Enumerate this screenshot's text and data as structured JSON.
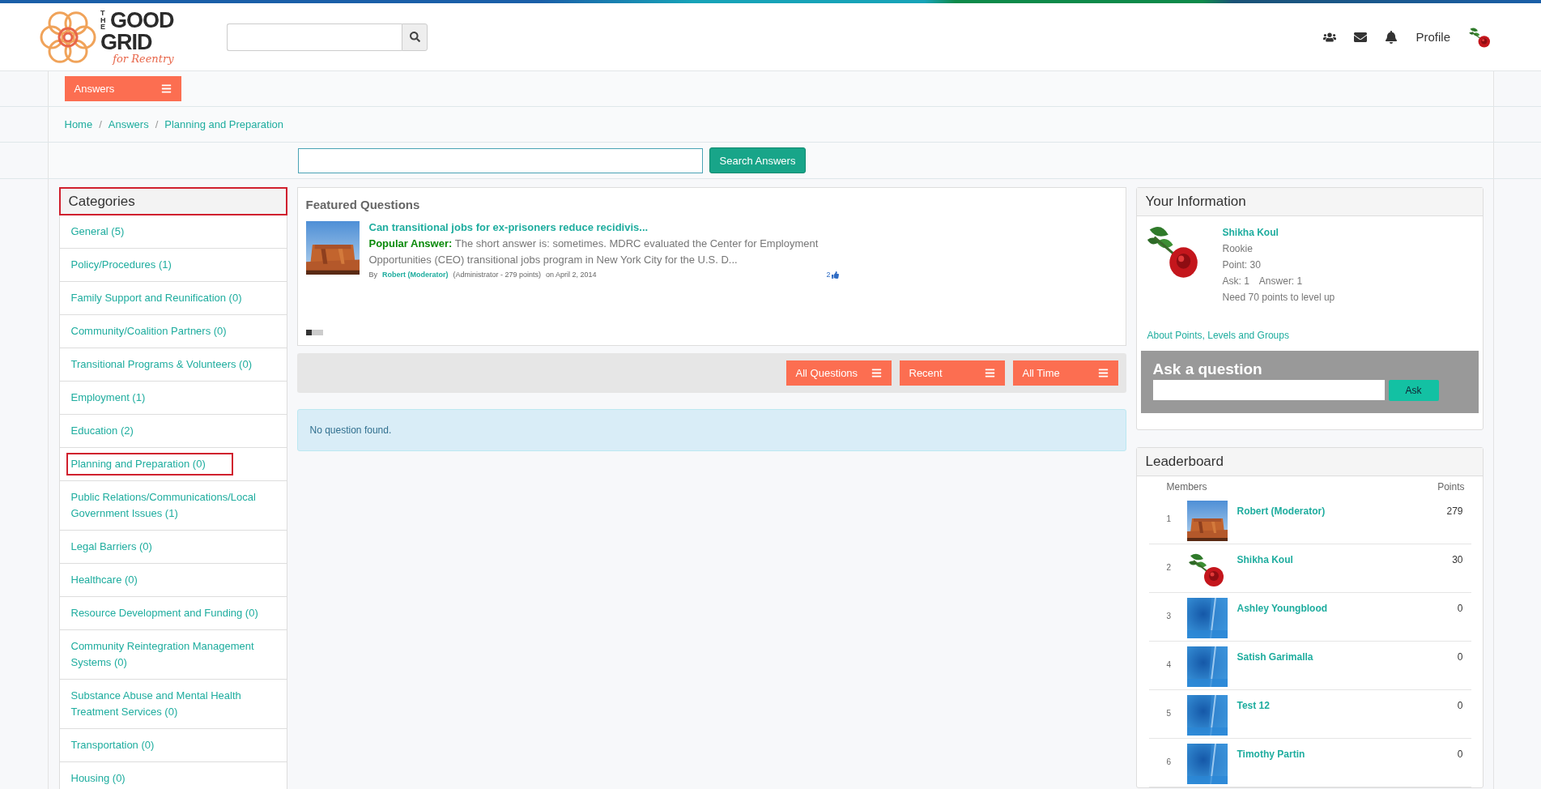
{
  "header": {
    "logo": {
      "small": "THE",
      "line1": "GOOD",
      "line2": "GRID",
      "tagline": "for Reentry"
    },
    "profile_link": "Profile"
  },
  "menu_button": "Answers",
  "breadcrumb": [
    {
      "kind": "link",
      "text": "Home"
    },
    {
      "kind": "separator",
      "text": "/"
    },
    {
      "kind": "link",
      "text": "Answers"
    },
    {
      "kind": "separator",
      "text": "/"
    },
    {
      "kind": "link",
      "text": "Planning and Preparation"
    }
  ],
  "search_button": "Search Answers",
  "categories": {
    "title": "Categories",
    "highlighted": true,
    "items": [
      {
        "label": "General (5)",
        "highlighted": false
      },
      {
        "label": "Policy/Procedures (1)",
        "highlighted": false
      },
      {
        "label": "Family Support and Reunification (0)",
        "highlighted": false
      },
      {
        "label": "Community/Coalition Partners (0)",
        "highlighted": false
      },
      {
        "label": "Transitional Programs & Volunteers (0)",
        "highlighted": false
      },
      {
        "label": "Employment (1)",
        "highlighted": false
      },
      {
        "label": "Education (2)",
        "highlighted": false
      },
      {
        "label": "Planning and Preparation (0)",
        "highlighted": true
      },
      {
        "label": "Public Relations/Communications/Local Government Issues (1)",
        "highlighted": false
      },
      {
        "label": "Legal Barriers (0)",
        "highlighted": false
      },
      {
        "label": "Healthcare (0)",
        "highlighted": false
      },
      {
        "label": "Resource Development and Funding (0)",
        "highlighted": false
      },
      {
        "label": "Community Reintegration Management Systems (0)",
        "highlighted": false
      },
      {
        "label": "Substance Abuse and Mental Health Treatment Services (0)",
        "highlighted": false
      },
      {
        "label": "Transportation (0)",
        "highlighted": false
      },
      {
        "label": "Housing (0)",
        "highlighted": false
      }
    ]
  },
  "featured": {
    "title": "Featured Questions",
    "question": "Can transitional jobs for ex-prisoners reduce recidivis...",
    "answer_label": "Popular Answer:",
    "answer": "The short answer is: sometimes. MDRC evaluated the Center for Employment Opportunities (CEO) transitional jobs program in New York City for the U.S. D...",
    "by": "By",
    "author": "Robert (Moderator)",
    "author_info": "(Administrator - 279 points)",
    "date": "on April 2, 2014",
    "likes": "2",
    "pager": [
      {
        "selected": true
      },
      {
        "selected": false
      },
      {
        "selected": false
      }
    ]
  },
  "filters": [
    "All Questions",
    "Recent",
    "All Time"
  ],
  "notice": "No question found.",
  "your_info": {
    "title": "Your Information",
    "name": "Shikha Koul",
    "level": "Rookie",
    "points": "Point: 30",
    "ask": "Ask: 1",
    "answer": "Answer: 1",
    "need": "Need 70 points to level up",
    "link": "About Points, Levels and Groups"
  },
  "ask": {
    "title": "Ask a question",
    "button": "Ask"
  },
  "leaderboard": {
    "title": "Leaderboard",
    "col_members": "Members",
    "col_points": "Points",
    "rows": [
      {
        "rank": "1",
        "name": "Robert (Moderator)",
        "points": "279",
        "kind": "landscape"
      },
      {
        "rank": "2",
        "name": "Shikha Koul",
        "points": "30",
        "kind": "flower"
      },
      {
        "rank": "3",
        "name": "Ashley Youngblood",
        "points": "0",
        "kind": "default"
      },
      {
        "rank": "4",
        "name": "Satish Garimalla",
        "points": "0",
        "kind": "default"
      },
      {
        "rank": "5",
        "name": "Test 12",
        "points": "0",
        "kind": "default"
      },
      {
        "rank": "6",
        "name": "Timothy Partin",
        "points": "0",
        "kind": "default"
      }
    ]
  }
}
